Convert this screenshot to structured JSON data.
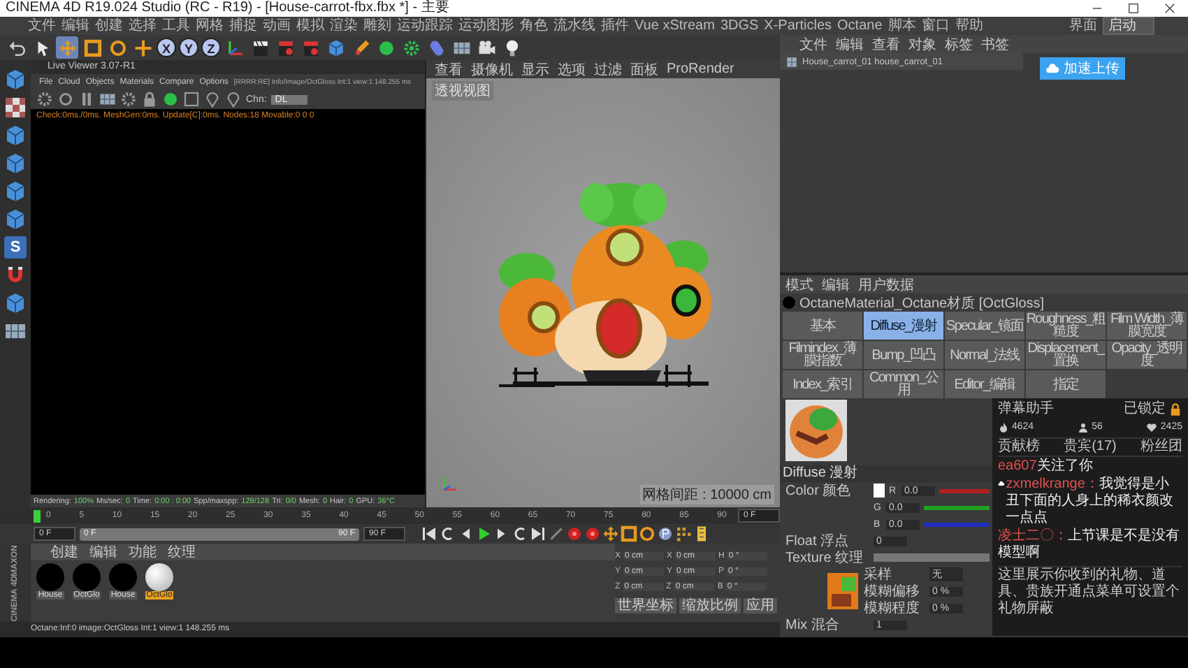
{
  "window": {
    "title": "CINEMA 4D R19.024 Studio (RC - R19) - [House-carrot-fbx.fbx *] - 主要",
    "controls": [
      {
        "kind": "minimize"
      },
      {
        "kind": "maximize"
      },
      {
        "kind": "close"
      }
    ]
  },
  "menu_bar": {
    "items": [
      "文件",
      "编辑",
      "创建",
      "选择",
      "工具",
      "网格",
      "捕捉",
      "动画",
      "模拟",
      "渲染",
      "雕刻",
      "运动跟踪",
      "运动图形",
      "角色",
      "流水线",
      "插件",
      "Vue xStream",
      "3DGS",
      "X-Particles",
      "Octane",
      "脚本",
      "窗口",
      "帮助"
    ],
    "layout_label": "界面",
    "layout_value": "启动"
  },
  "toolbar": {
    "tools": [
      {
        "kind": "undo",
        "selected": false
      },
      {
        "kind": "cursor",
        "selected": false
      },
      {
        "kind": "move",
        "selected": true
      },
      {
        "kind": "scale",
        "selected": false
      },
      {
        "kind": "rotate",
        "selected": false
      },
      {
        "kind": "plus",
        "selected": false
      },
      {
        "kind": "axis",
        "label": "X",
        "selected": true
      },
      {
        "kind": "axis",
        "label": "Y",
        "selected": true
      },
      {
        "kind": "axis",
        "label": "Z",
        "selected": true
      },
      {
        "kind": "coord",
        "selected": false
      },
      {
        "kind": "clapper",
        "selected": false
      },
      {
        "kind": "clapper-red",
        "selected": false
      },
      {
        "kind": "clapper-red",
        "selected": false
      },
      {
        "kind": "cube",
        "selected": false
      },
      {
        "kind": "pen",
        "selected": false
      },
      {
        "kind": "sphere",
        "selected": false
      },
      {
        "kind": "gear",
        "selected": false
      },
      {
        "kind": "capsule",
        "selected": false
      },
      {
        "kind": "grid",
        "selected": false
      },
      {
        "kind": "camera",
        "selected": false
      },
      {
        "kind": "bulb",
        "selected": false
      }
    ]
  },
  "mode_strip": {
    "tools": [
      {
        "kind": "cube"
      },
      {
        "kind": "checker"
      },
      {
        "kind": "cube"
      },
      {
        "kind": "cube"
      },
      {
        "kind": "cube"
      },
      {
        "kind": "cube"
      },
      {
        "kind": "letter",
        "glyph": "S"
      },
      {
        "kind": "magnet"
      },
      {
        "kind": "cube"
      },
      {
        "kind": "grid"
      }
    ]
  },
  "live_viewer": {
    "title": "Live Viewer 3.07-R1",
    "menu": [
      "File",
      "Cloud",
      "Objects",
      "Materials",
      "Compare",
      "Options"
    ],
    "path": "[RRRR:RE] Info/Image/OctGloss Int:1 view:1 148.255 ms",
    "tools": [
      {
        "kind": "settings"
      },
      {
        "kind": "circle"
      },
      {
        "kind": "pause"
      },
      {
        "kind": "grid"
      },
      {
        "kind": "settings"
      },
      {
        "kind": "lock"
      },
      {
        "kind": "sphere"
      },
      {
        "kind": "square"
      },
      {
        "kind": "pin"
      },
      {
        "kind": "pin"
      }
    ],
    "channel_label": "Chn:",
    "channel_value": "DL",
    "status": "Check:0ms./0ms. MeshGen:0ms. Update[C]:0ms. Nodes:18 Movable:0 0 0",
    "stats": [
      {
        "label": "Rendering:",
        "value": "100%"
      },
      {
        "label": "Ms/sec:",
        "value": "0"
      },
      {
        "label": "Time:",
        "value": "0:00 : 0:00"
      },
      {
        "label": "Spp/maxspp:",
        "value": "128/128"
      },
      {
        "label": "Tri:",
        "value": "0/0"
      },
      {
        "label": "Mesh:",
        "value": "0"
      },
      {
        "label": "Hair:",
        "value": "0"
      },
      {
        "label": "GPU:",
        "value": "36°C"
      }
    ]
  },
  "viewport": {
    "menu": [
      "查看",
      "摄像机",
      "显示",
      "选项",
      "过滤",
      "面板",
      "ProRender"
    ],
    "view_name": "透视视图",
    "grid_spacing": "网格间距 : 10000 cm"
  },
  "object_manager": {
    "menu": [
      "文件",
      "编辑",
      "查看",
      "对象",
      "标签",
      "书签"
    ],
    "objects": [
      {
        "name": "House_carrot_01 house_carrot_01"
      }
    ]
  },
  "upload_button": {
    "label": "加速上传"
  },
  "attributes": {
    "menu": [
      "模式",
      "编辑",
      "用户数据"
    ],
    "material": "OctaneMaterial_Octane材质 [OctGloss]",
    "tabs": [
      {
        "label": "基本",
        "selected": false
      },
      {
        "label": "Diffuse_漫射",
        "selected": true
      },
      {
        "label": "Specular_镜面",
        "selected": false
      },
      {
        "label": "Roughness_粗糙度",
        "selected": false
      },
      {
        "label": "Film Width_薄膜宽度",
        "selected": false
      },
      {
        "label": "Filmindex_薄膜指数",
        "selected": false
      },
      {
        "label": "Bump_凹凸",
        "selected": false
      },
      {
        "label": "Normal_法线",
        "selected": false
      },
      {
        "label": "Displacement_置换",
        "selected": false
      },
      {
        "label": "Opacity_透明度",
        "selected": false
      },
      {
        "label": "Index_索引",
        "selected": false
      },
      {
        "label": "Common_公用",
        "selected": false
      },
      {
        "label": "Editor_编辑",
        "selected": false
      },
      {
        "label": "指定",
        "selected": false
      }
    ],
    "section": "Diffuse 漫射",
    "color_label": "Color 颜色",
    "channels": [
      {
        "name": "R",
        "value": "0.0",
        "color": "#b02020"
      },
      {
        "name": "G",
        "value": "0.0",
        "color": "#20a020"
      },
      {
        "name": "B",
        "value": "0.0",
        "color": "#2030c0"
      }
    ],
    "float_label": "Float 浮点",
    "float_value": "0",
    "texture_label": "Texture 纹理",
    "texture_params": [
      {
        "label": "采样",
        "value": "无"
      },
      {
        "label": "模糊偏移",
        "value": "0 %"
      },
      {
        "label": "模糊程度",
        "value": "0 %"
      }
    ],
    "mix_label": "Mix 混合",
    "mix_value": "1"
  },
  "chat": {
    "title": "弹幕助手",
    "lock_label": "已锁定",
    "stats": [
      {
        "kind": "flame",
        "value": "4624"
      },
      {
        "kind": "person",
        "value": "56"
      },
      {
        "kind": "heart",
        "value": "2425"
      }
    ],
    "tabs": [
      "贡献榜",
      "贵宾(17)",
      "粉丝团"
    ],
    "messages": [
      {
        "kind": "follow",
        "user": "ea607",
        "text": "关注了你"
      },
      {
        "kind": "chat",
        "user": "zxmelkrange：",
        "text": "我觉得是小丑下面的人身上的稀衣颜改一点点"
      },
      {
        "kind": "chat",
        "user": "凌士二〇：",
        "text": "上节课是不是没有模型啊"
      }
    ],
    "notice": "这里展示你收到的礼物、道具、贵族开通点菜单可设置个礼物屏蔽"
  },
  "timeline": {
    "ticks": [
      "0",
      "5",
      "10",
      "15",
      "20",
      "25",
      "30",
      "35",
      "40",
      "45",
      "50",
      "55",
      "60",
      "65",
      "70",
      "75",
      "80",
      "85",
      "90"
    ],
    "current": "0 F",
    "start": "0 F",
    "range_start": "0 F",
    "range_end": "90 F",
    "end": "90 F",
    "range_slider": {
      "level": 1
    },
    "transport": [
      {
        "kind": "to-start"
      },
      {
        "kind": "loop"
      },
      {
        "kind": "step-back"
      },
      {
        "kind": "play"
      },
      {
        "kind": "step-forward"
      },
      {
        "kind": "loop"
      },
      {
        "kind": "to-end"
      },
      {
        "kind": "key"
      },
      {
        "kind": "record"
      },
      {
        "kind": "record"
      },
      {
        "kind": "move"
      },
      {
        "kind": "scale"
      },
      {
        "kind": "rotate"
      },
      {
        "kind": "param"
      },
      {
        "kind": "dots"
      },
      {
        "kind": "film"
      }
    ]
  },
  "material_manager": {
    "menu": [
      "创建",
      "编辑",
      "功能",
      "纹理"
    ],
    "materials": [
      {
        "name": "House",
        "kind": "dark",
        "selected": false
      },
      {
        "name": "OctGlo",
        "kind": "dark",
        "selected": false
      },
      {
        "name": "House",
        "kind": "dark",
        "selected": false
      },
      {
        "name": "OctGlo",
        "kind": "light",
        "selected": true
      }
    ]
  },
  "brand": [
    "MAXON",
    "CINEMA 4D"
  ],
  "coordinates": {
    "rows": [
      [
        {
          "axis": "X",
          "value": "0 cm"
        },
        {
          "axis": "X",
          "value": "0 cm"
        },
        {
          "axis": "H",
          "value": "0 °"
        }
      ],
      [
        {
          "axis": "Y",
          "value": "0 cm"
        },
        {
          "axis": "Y",
          "value": "0 cm"
        },
        {
          "axis": "P",
          "value": "0 °"
        }
      ],
      [
        {
          "axis": "Z",
          "value": "0 cm"
        },
        {
          "axis": "Z",
          "value": "0 cm"
        },
        {
          "axis": "B",
          "value": "0 °"
        }
      ]
    ],
    "buttons": [
      "世界坐标",
      "缩放比例",
      "应用"
    ]
  },
  "status_bar": {
    "text": "Octane:Inf:0 image:OctGloss Int:1 view:1 148.255 ms"
  }
}
